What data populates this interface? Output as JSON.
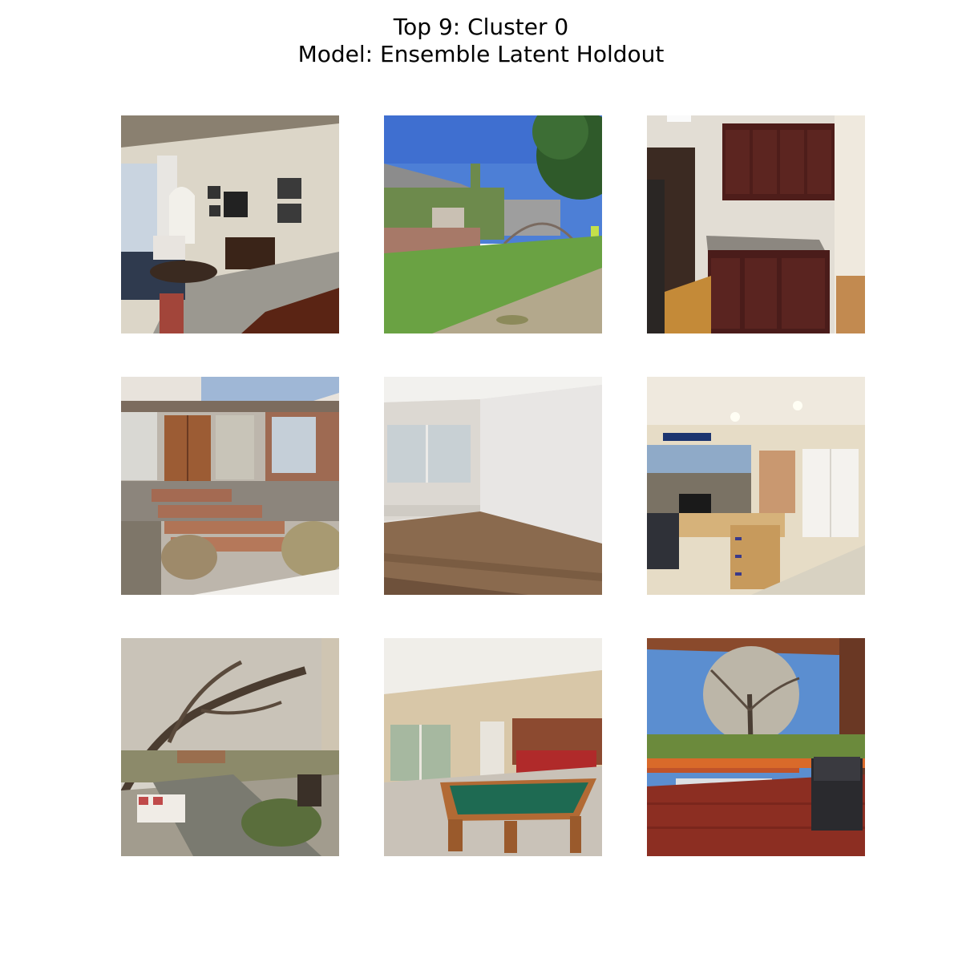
{
  "figure": {
    "title_line1": "Top 9: Cluster 0",
    "title_line2": "Model: Ensemble Latent Holdout"
  },
  "images": [
    {
      "scene": "living-room"
    },
    {
      "scene": "house-exterior-lawn"
    },
    {
      "scene": "kitchen-cabinets"
    },
    {
      "scene": "front-entry-steps"
    },
    {
      "scene": "empty-room-wood-floor"
    },
    {
      "scene": "home-office"
    },
    {
      "scene": "backyard-tree-bench"
    },
    {
      "scene": "basement-pool-table"
    },
    {
      "scene": "deck-with-grill"
    }
  ]
}
